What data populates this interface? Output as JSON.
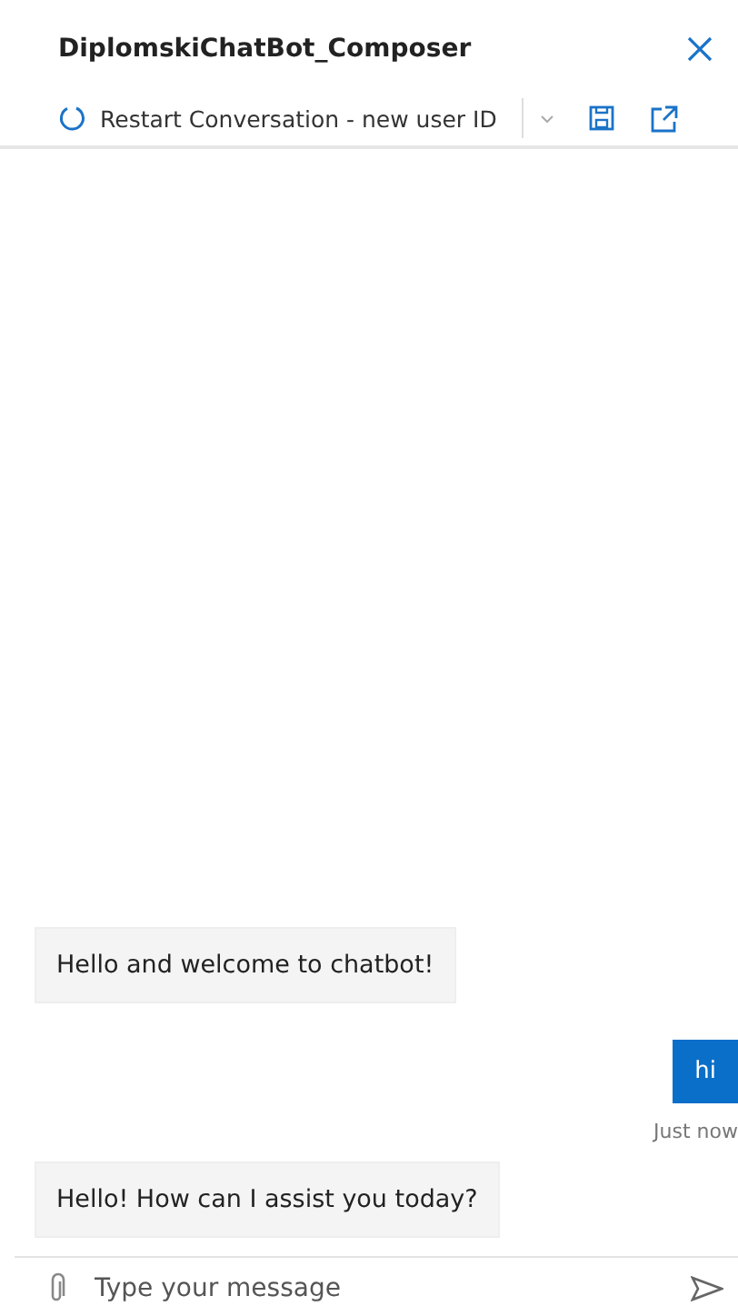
{
  "window": {
    "title": "DiplomskiChatBot_Composer"
  },
  "toolbar": {
    "restart_label": "Restart Conversation - new user ID"
  },
  "messages": [
    {
      "kind": "bot",
      "text": "Hello and welcome to chatbot!"
    },
    {
      "kind": "user",
      "text": "hi",
      "time": "Just now"
    },
    {
      "kind": "bot",
      "text": "Hello! How can I assist you today?"
    }
  ],
  "composer": {
    "placeholder": "Type your message"
  }
}
